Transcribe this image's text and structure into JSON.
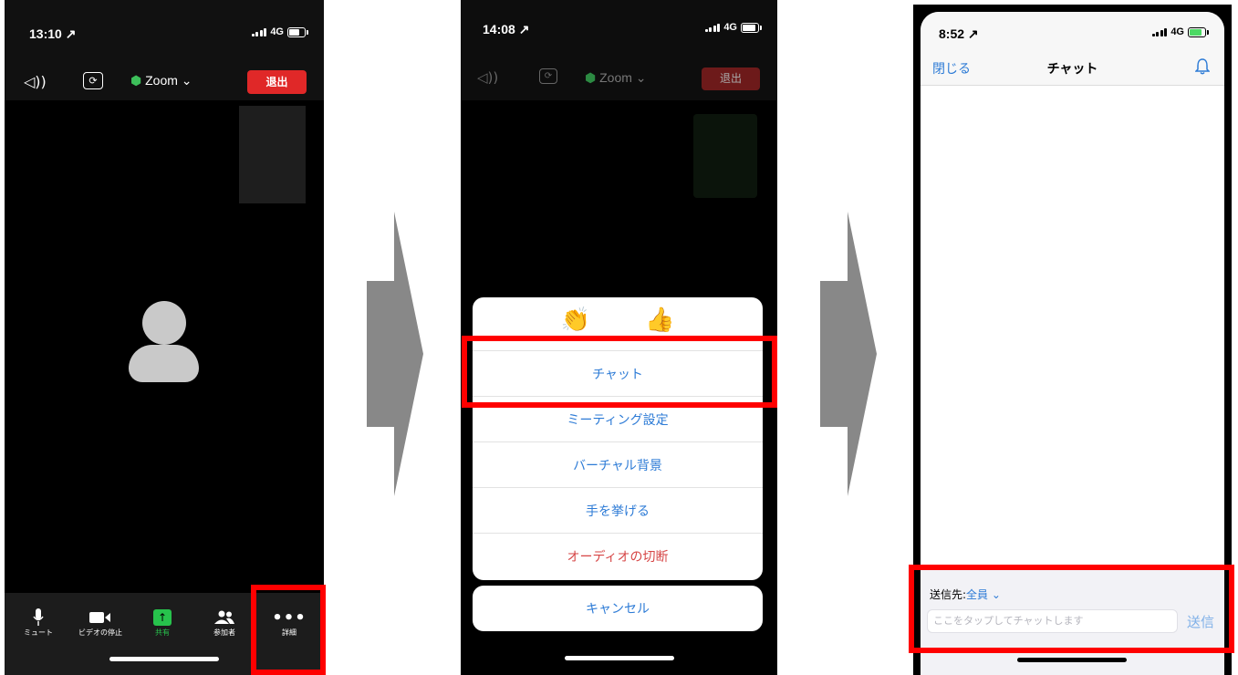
{
  "phone1": {
    "status": {
      "time": "13:10",
      "network": "4G"
    },
    "header": {
      "speaker_icon": "speaker-icon",
      "camera_icon": "camera-switch-icon",
      "meeting_name": "Zoom",
      "leave_button": "退出"
    },
    "toolbar": [
      {
        "label": "ミュート",
        "icon": "microphone-icon"
      },
      {
        "label": "ビデオの停止",
        "icon": "video-camera-icon"
      },
      {
        "label": "共有",
        "icon": "share-icon"
      },
      {
        "label": "参加者",
        "icon": "participants-icon"
      },
      {
        "label": "詳細",
        "icon": "more-icon"
      }
    ]
  },
  "phone2": {
    "status": {
      "time": "14:08",
      "network": "4G"
    },
    "header": {
      "meeting_name": "Zoom",
      "leave_button": "退出"
    },
    "reactions": [
      "👏",
      "👍"
    ],
    "menu": {
      "chat": "チャット",
      "meeting_settings": "ミーティング設定",
      "virtual_background": "バーチャル背景",
      "raise_hand": "手を挙げる",
      "disconnect_audio": "オーディオの切断",
      "cancel": "キャンセル"
    }
  },
  "phone3": {
    "status": {
      "time": "8:52",
      "network": "4G"
    },
    "nav": {
      "close": "閉じる",
      "title": "チャット",
      "bell_icon": "bell-icon"
    },
    "composer": {
      "send_to_label": "送信先:",
      "recipient": "全員",
      "placeholder": "ここをタップしてチャットします",
      "send": "送信"
    }
  },
  "colors": {
    "highlight": "#ff0000",
    "zoom_blue": "#2d7bd6",
    "leave_red": "#e02828",
    "share_green": "#27c24c",
    "arrow_gray": "#888888"
  }
}
